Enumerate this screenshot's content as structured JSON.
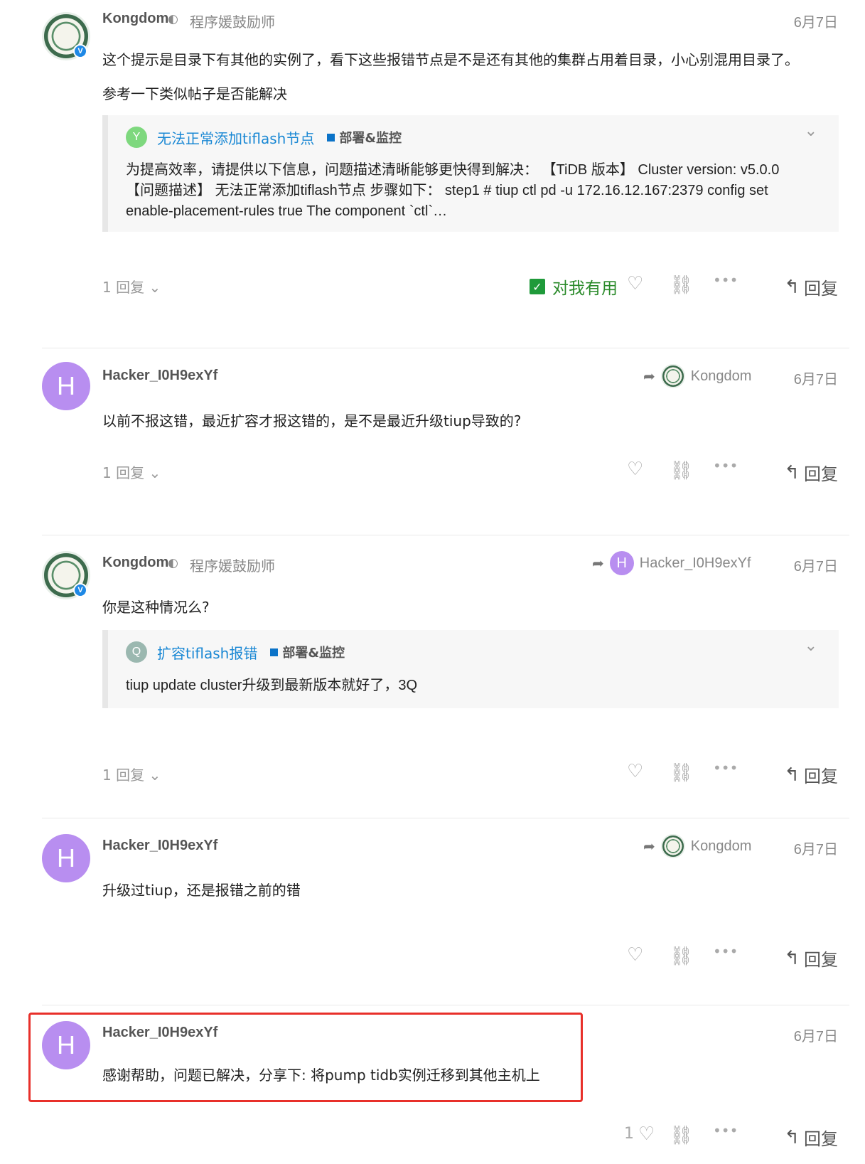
{
  "posts": [
    {
      "username": "Kongdom",
      "user_title": "程序媛鼓励师",
      "date": "6月7日",
      "paragraphs": [
        "这个提示是目录下有其他的实例了，看下这些报错节点是不是还有其他的集群占用着目录，小心别混用目录了。",
        "参考一下类似帖子是否能解决"
      ],
      "quote": {
        "avatar_letter": "Y",
        "avatar_color": "#7ed87e",
        "title": "无法正常添加tiflash节点",
        "category": "部署&监控",
        "body": "为提高效率，请提供以下信息，问题描述清晰能够更快得到解决： 【TiDB 版本】 Cluster version: v5.0.0 【问题描述】 无法正常添加tiflash节点 步骤如下： step1 # tiup ctl pd -u 172.16.12.167:2379 config set enable-placement-rules true The component `ctl`…"
      },
      "replies": "1 回复",
      "useful_label": "对我有用",
      "reply_label": "回复"
    },
    {
      "username": "Hacker_I0H9exYf",
      "avatar_letter": "H",
      "reply_to": "Kongdom",
      "date": "6月7日",
      "paragraphs": [
        "以前不报这错，最近扩容才报这错的，是不是最近升级tiup导致的?"
      ],
      "replies": "1 回复",
      "reply_label": "回复"
    },
    {
      "username": "Kongdom",
      "user_title": "程序媛鼓励师",
      "reply_to": "Hacker_I0H9exYf",
      "reply_to_letter": "H",
      "date": "6月7日",
      "paragraphs": [
        "你是这种情况么?"
      ],
      "quote": {
        "avatar_letter": "Q",
        "avatar_color": "#9bb8b0",
        "title": "扩容tiflash报错",
        "category": "部署&监控",
        "body": "tiup update cluster升级到最新版本就好了，3Q"
      },
      "replies": "1 回复",
      "reply_label": "回复"
    },
    {
      "username": "Hacker_I0H9exYf",
      "avatar_letter": "H",
      "reply_to": "Kongdom",
      "date": "6月7日",
      "paragraphs": [
        "升级过tiup，还是报错之前的错"
      ],
      "reply_label": "回复"
    },
    {
      "username": "Hacker_I0H9exYf",
      "avatar_letter": "H",
      "date": "6月7日",
      "paragraphs": [
        "感谢帮助，问题已解决，分享下: 将pump tidb实例迁移到其他主机上"
      ],
      "like_count": "1",
      "reply_label": "回复"
    }
  ],
  "icons": {
    "verified": "V",
    "shield": "shield-icon",
    "heart": "♡",
    "link": "link-icon",
    "more": "•••",
    "reply_arrow": "↰",
    "share_arrow": "share-arrow-icon",
    "chevron": "⌄"
  }
}
